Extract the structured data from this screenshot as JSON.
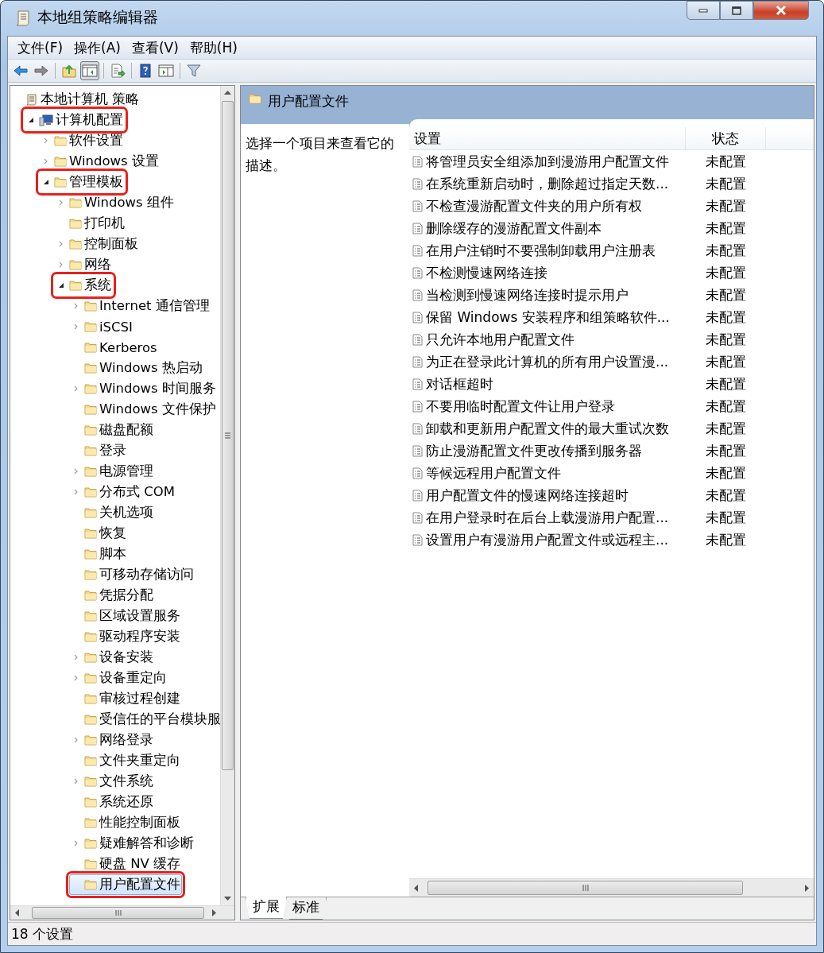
{
  "window": {
    "title": "本地组策略编辑器"
  },
  "menu": [
    "文件(F)",
    "操作(A)",
    "查看(V)",
    "帮助(H)"
  ],
  "toolbar": [
    {
      "kind": "back",
      "disabled": false
    },
    {
      "kind": "forward",
      "disabled": true
    },
    {
      "kind": "sep"
    },
    {
      "kind": "up"
    },
    {
      "kind": "tree",
      "pressed": true
    },
    {
      "kind": "sep"
    },
    {
      "kind": "export"
    },
    {
      "kind": "sep"
    },
    {
      "kind": "help"
    },
    {
      "kind": "pane"
    },
    {
      "kind": "sep"
    },
    {
      "kind": "filter"
    }
  ],
  "tree": [
    {
      "label": "本地计算机 策略",
      "expandable": false,
      "selected": false,
      "annotated": false,
      "children": [
        {
          "label": "计算机配置",
          "expandable": true,
          "expanded": true,
          "selected": false,
          "annotated": true,
          "children": [
            {
              "label": "软件设置",
              "expandable": true,
              "expanded": false,
              "selected": false,
              "annotated": false
            },
            {
              "label": "Windows 设置",
              "expandable": true,
              "expanded": false,
              "selected": false,
              "annotated": false
            },
            {
              "label": "管理模板",
              "expandable": true,
              "expanded": true,
              "selected": false,
              "annotated": true,
              "children": [
                {
                  "label": "Windows 组件",
                  "expandable": true,
                  "expanded": false,
                  "selected": false,
                  "annotated": false
                },
                {
                  "label": "打印机",
                  "expandable": false,
                  "selected": false,
                  "annotated": false
                },
                {
                  "label": "控制面板",
                  "expandable": true,
                  "expanded": false,
                  "selected": false,
                  "annotated": false
                },
                {
                  "label": "网络",
                  "expandable": true,
                  "expanded": false,
                  "selected": false,
                  "annotated": false
                },
                {
                  "label": "系统",
                  "expandable": true,
                  "expanded": true,
                  "selected": false,
                  "annotated": true,
                  "children": [
                    {
                      "label": "Internet 通信管理",
                      "expandable": true,
                      "expanded": false,
                      "selected": false,
                      "annotated": false
                    },
                    {
                      "label": "iSCSI",
                      "expandable": true,
                      "expanded": false,
                      "selected": false,
                      "annotated": false
                    },
                    {
                      "label": "Kerberos",
                      "expandable": false,
                      "selected": false,
                      "annotated": false
                    },
                    {
                      "label": "Windows 热启动",
                      "expandable": false,
                      "selected": false,
                      "annotated": false
                    },
                    {
                      "label": "Windows 时间服务",
                      "expandable": true,
                      "expanded": false,
                      "selected": false,
                      "annotated": false
                    },
                    {
                      "label": "Windows 文件保护",
                      "expandable": false,
                      "selected": false,
                      "annotated": false
                    },
                    {
                      "label": "磁盘配额",
                      "expandable": false,
                      "selected": false,
                      "annotated": false
                    },
                    {
                      "label": "登录",
                      "expandable": false,
                      "selected": false,
                      "annotated": false
                    },
                    {
                      "label": "电源管理",
                      "expandable": true,
                      "expanded": false,
                      "selected": false,
                      "annotated": false
                    },
                    {
                      "label": "分布式 COM",
                      "expandable": true,
                      "expanded": false,
                      "selected": false,
                      "annotated": false
                    },
                    {
                      "label": "关机选项",
                      "expandable": false,
                      "selected": false,
                      "annotated": false
                    },
                    {
                      "label": "恢复",
                      "expandable": false,
                      "selected": false,
                      "annotated": false
                    },
                    {
                      "label": "脚本",
                      "expandable": false,
                      "selected": false,
                      "annotated": false
                    },
                    {
                      "label": "可移动存储访问",
                      "expandable": false,
                      "selected": false,
                      "annotated": false
                    },
                    {
                      "label": "凭据分配",
                      "expandable": false,
                      "selected": false,
                      "annotated": false
                    },
                    {
                      "label": "区域设置服务",
                      "expandable": false,
                      "selected": false,
                      "annotated": false
                    },
                    {
                      "label": "驱动程序安装",
                      "expandable": false,
                      "selected": false,
                      "annotated": false
                    },
                    {
                      "label": "设备安装",
                      "expandable": true,
                      "expanded": false,
                      "selected": false,
                      "annotated": false
                    },
                    {
                      "label": "设备重定向",
                      "expandable": true,
                      "expanded": false,
                      "selected": false,
                      "annotated": false
                    },
                    {
                      "label": "审核过程创建",
                      "expandable": false,
                      "selected": false,
                      "annotated": false
                    },
                    {
                      "label": "受信任的平台模块服",
                      "expandable": false,
                      "selected": false,
                      "annotated": false
                    },
                    {
                      "label": "网络登录",
                      "expandable": true,
                      "expanded": false,
                      "selected": false,
                      "annotated": false
                    },
                    {
                      "label": "文件夹重定向",
                      "expandable": false,
                      "selected": false,
                      "annotated": false
                    },
                    {
                      "label": "文件系统",
                      "expandable": true,
                      "expanded": false,
                      "selected": false,
                      "annotated": false
                    },
                    {
                      "label": "系统还原",
                      "expandable": false,
                      "selected": false,
                      "annotated": false
                    },
                    {
                      "label": "性能控制面板",
                      "expandable": false,
                      "selected": false,
                      "annotated": false
                    },
                    {
                      "label": "疑难解答和诊断",
                      "expandable": true,
                      "expanded": false,
                      "selected": false,
                      "annotated": false
                    },
                    {
                      "label": "硬盘 NV 缓存",
                      "expandable": false,
                      "selected": false,
                      "annotated": false
                    },
                    {
                      "label": "用户配置文件",
                      "expandable": false,
                      "selected": true,
                      "annotated": true
                    }
                  ]
                }
              ]
            }
          ]
        }
      ]
    }
  ],
  "details": {
    "heading": "用户配置文件",
    "description": "选择一个项目来查看它的描述。",
    "columns": [
      "设置",
      "状态"
    ],
    "rows": [
      {
        "setting": "将管理员安全组添加到漫游用户配置文件",
        "state": "未配置"
      },
      {
        "setting": "在系统重新启动时，删除超过指定天数...",
        "state": "未配置"
      },
      {
        "setting": "不检查漫游配置文件夹的用户所有权",
        "state": "未配置"
      },
      {
        "setting": "删除缓存的漫游配置文件副本",
        "state": "未配置"
      },
      {
        "setting": "在用户注销时不要强制卸载用户注册表",
        "state": "未配置"
      },
      {
        "setting": "不检测慢速网络连接",
        "state": "未配置"
      },
      {
        "setting": "当检测到慢速网络连接时提示用户",
        "state": "未配置"
      },
      {
        "setting": "保留 Windows 安装程序和组策略软件...",
        "state": "未配置"
      },
      {
        "setting": "只允许本地用户配置文件",
        "state": "未配置"
      },
      {
        "setting": "为正在登录此计算机的所有用户设置漫...",
        "state": "未配置"
      },
      {
        "setting": "对话框超时",
        "state": "未配置"
      },
      {
        "setting": "不要用临时配置文件让用户登录",
        "state": "未配置"
      },
      {
        "setting": "卸载和更新用户配置文件的最大重试次数",
        "state": "未配置"
      },
      {
        "setting": "防止漫游配置文件更改传播到服务器",
        "state": "未配置"
      },
      {
        "setting": "等候远程用户配置文件",
        "state": "未配置"
      },
      {
        "setting": "用户配置文件的慢速网络连接超时",
        "state": "未配置"
      },
      {
        "setting": "在用户登录时在后台上载漫游用户配置...",
        "state": "未配置"
      },
      {
        "setting": "设置用户有漫游用户配置文件或远程主...",
        "state": "未配置"
      }
    ]
  },
  "view_tabs": [
    {
      "label": "扩展",
      "selected": true
    },
    {
      "label": "标准",
      "selected": false
    }
  ],
  "status_bar": "18 个设置"
}
